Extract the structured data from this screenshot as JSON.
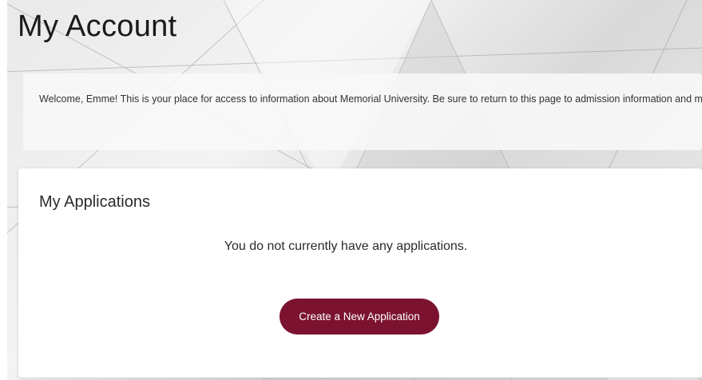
{
  "header": {
    "title": "My Account"
  },
  "welcome": {
    "text": "Welcome, Emme! This is your place for access to information about Memorial University. Be sure to return to this page to admission information and more."
  },
  "applications": {
    "title": "My Applications",
    "empty_message": "You do not currently have any applications.",
    "create_button_label": "Create a New Application"
  },
  "colors": {
    "button_background": "#7b1230",
    "button_text": "#ffffff"
  }
}
